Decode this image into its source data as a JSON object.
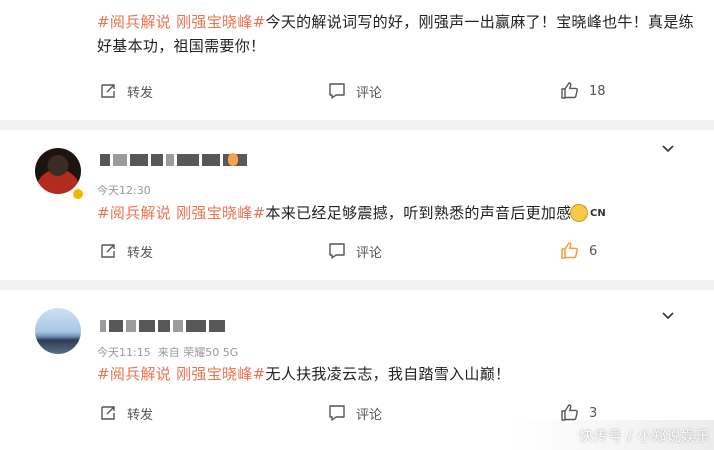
{
  "posts": [
    {
      "tag_text": "#阅兵解说 刚强宝晓峰#",
      "text": "今天的解说词写的好，刚强声一出赢麻了！宝晓峰也牛！真是练",
      "text_line2": "好基本功，祖国需要你！",
      "repost_label": "转发",
      "comment_label": "评论",
      "like_count": "18"
    },
    {
      "time": "今天12:30",
      "tag_text": "#阅兵解说 刚强宝晓峰#",
      "text": "本来已经足够震撼，听到熟悉的声音后更加感慨",
      "badge": "CN",
      "repost_label": "转发",
      "comment_label": "评论",
      "like_count": "6",
      "liked_color": "#f0a030"
    },
    {
      "time": "今天11:15",
      "source": "来自 荣耀50 5G",
      "tag_text": "#阅兵解说 刚强宝晓峰#",
      "text": "无人扶我凌云志，我自踏雪入山巅！",
      "repost_label": "转发",
      "comment_label": "评论",
      "like_count": "3"
    }
  ],
  "watermark": "快传号 / 小郑说娱乐",
  "colors": {
    "tag": "#eb7350",
    "text": "#222222",
    "meta": "#999999",
    "background": "#f2f2f2",
    "like_active": "#f0a030"
  },
  "icons": {
    "repost": "repost-icon",
    "comment": "comment-icon",
    "like": "thumbs-up-icon",
    "menu": "chevron-down-icon"
  }
}
